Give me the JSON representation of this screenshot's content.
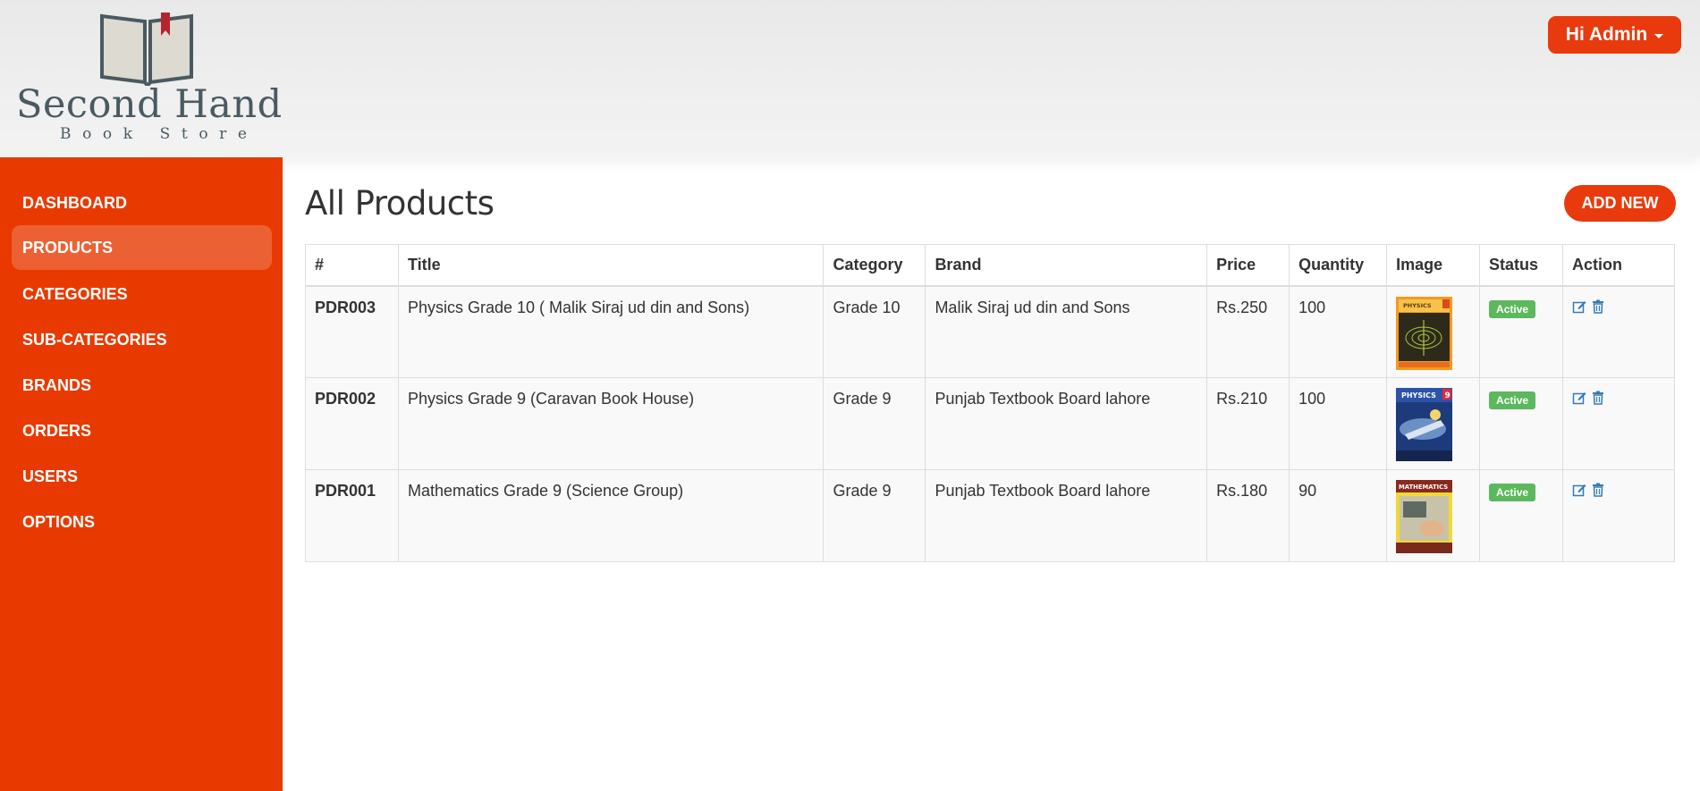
{
  "header": {
    "logo_title": "Second Hand",
    "logo_subtitle": "Book Store",
    "user_button": "Hi Admin"
  },
  "sidebar": {
    "items": [
      {
        "label": "DASHBOARD",
        "active": false
      },
      {
        "label": "PRODUCTS",
        "active": true
      },
      {
        "label": "CATEGORIES",
        "active": false
      },
      {
        "label": "SUB-CATEGORIES",
        "active": false
      },
      {
        "label": "BRANDS",
        "active": false
      },
      {
        "label": "ORDERS",
        "active": false
      },
      {
        "label": "USERS",
        "active": false
      },
      {
        "label": "OPTIONS",
        "active": false
      }
    ]
  },
  "main": {
    "title": "All Products",
    "add_button": "ADD NEW",
    "table": {
      "headers": [
        "#",
        "Title",
        "Category",
        "Brand",
        "Price",
        "Quantity",
        "Image",
        "Status",
        "Action"
      ],
      "rows": [
        {
          "id": "PDR003",
          "title": "Physics Grade 10 ( Malik Siraj ud din and Sons)",
          "category": "Grade 10",
          "brand": "Malik Siraj ud din and Sons",
          "price": "Rs.250",
          "quantity": "100",
          "image": "physics-10-cover",
          "status": "Active"
        },
        {
          "id": "PDR002",
          "title": "Physics Grade 9 (Caravan Book House)",
          "category": "Grade 9",
          "brand": "Punjab Textbook Board lahore",
          "price": "Rs.210",
          "quantity": "100",
          "image": "physics-9-cover",
          "status": "Active"
        },
        {
          "id": "PDR001",
          "title": "Mathematics Grade 9 (Science Group)",
          "category": "Grade 9",
          "brand": "Punjab Textbook Board lahore",
          "price": "Rs.180",
          "quantity": "90",
          "image": "mathematics-9-cover",
          "status": "Active"
        }
      ]
    }
  },
  "cover_text": {
    "physics_10": "PHYSICS",
    "physics_9": "PHYSICS",
    "physics_9_badge": "9",
    "math_9": "MATHEMATICS"
  },
  "colors": {
    "accent": "#e83a00",
    "status_active": "#5cb85c",
    "action_icon": "#337ab7"
  }
}
